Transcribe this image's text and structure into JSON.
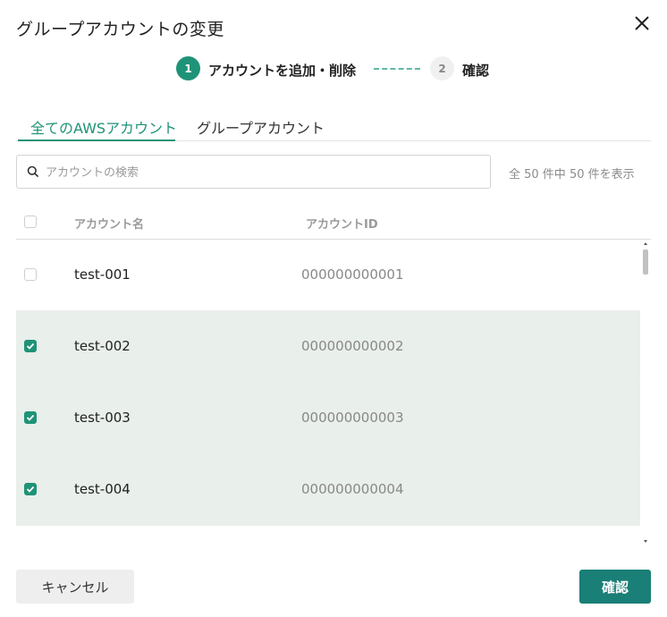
{
  "dialog": {
    "title": "グループアカウントの変更"
  },
  "stepper": {
    "steps": [
      {
        "number": "1",
        "label": "アカウントを追加・削除",
        "active": true
      },
      {
        "number": "2",
        "label": "確認",
        "active": false
      }
    ]
  },
  "tabs": [
    {
      "label": "全てのAWSアカウント",
      "active": true
    },
    {
      "label": "グループアカウント",
      "active": false
    }
  ],
  "search": {
    "placeholder": "アカウントの検索",
    "value": ""
  },
  "count_text": "全 50 件中 50 件を表示",
  "table": {
    "columns": [
      "アカウント名",
      "アカウントID"
    ],
    "header_checked": false,
    "rows": [
      {
        "name": "test-001",
        "id": "000000000001",
        "checked": false
      },
      {
        "name": "test-002",
        "id": "000000000002",
        "checked": true
      },
      {
        "name": "test-003",
        "id": "000000000003",
        "checked": true
      },
      {
        "name": "test-004",
        "id": "000000000004",
        "checked": true
      }
    ]
  },
  "buttons": {
    "cancel": "キャンセル",
    "confirm": "確認"
  },
  "colors": {
    "accent": "#1f9377",
    "confirm_button": "#1a7f76",
    "selected_row": "#e9efeb"
  }
}
